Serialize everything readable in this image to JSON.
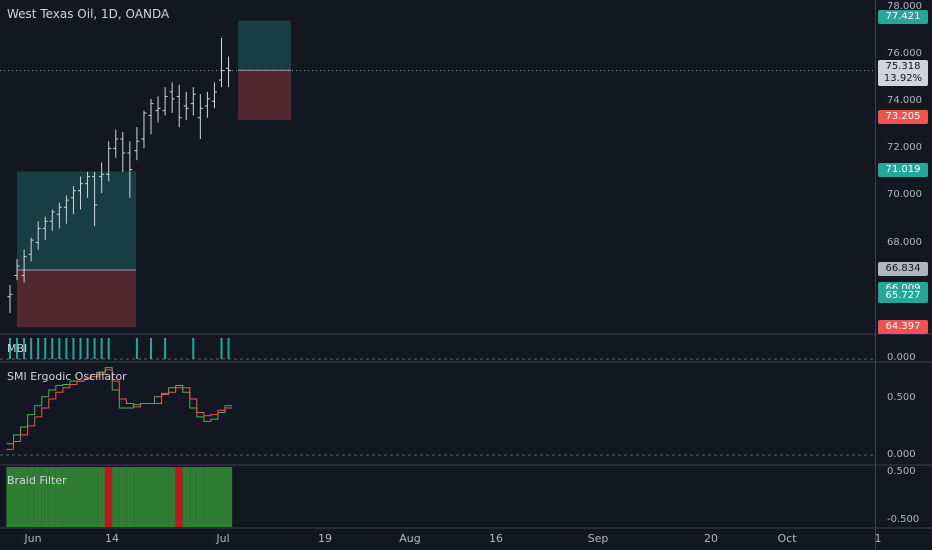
{
  "chart": {
    "title": "West Texas Oil, 1D, OANDA"
  },
  "price_axis": {
    "ticks": [
      "78.000",
      "76.000",
      "74.000",
      "72.000",
      "70.000",
      "68.000"
    ],
    "tags": [
      {
        "text": "77.421",
        "bg": "#26a69a",
        "fg": "#ffffff"
      },
      {
        "text": "75.318",
        "bg": "#d1d4dc",
        "fg": "#131722"
      },
      {
        "text": "13.92%",
        "bg": "#d1d4dc",
        "fg": "#131722"
      },
      {
        "text": "73.205",
        "bg": "#ef5350",
        "fg": "#ffffff"
      },
      {
        "text": "71.019",
        "bg": "#26a69a",
        "fg": "#ffffff"
      },
      {
        "text": "66.834",
        "bg": "#b2b5be",
        "fg": "#131722"
      },
      {
        "text": "66.009",
        "bg": "#26a69a",
        "fg": "#ffffff"
      },
      {
        "text": "65.727",
        "bg": "#26a69a",
        "fg": "#ffffff"
      },
      {
        "text": "64.397",
        "bg": "#ef5350",
        "fg": "#ffffff"
      }
    ]
  },
  "panels": {
    "mbi": {
      "label": "MBI",
      "tick": "0.000"
    },
    "smi": {
      "label": "SMI Ergodic Oscillator",
      "ticks": [
        "0.500",
        "0.000"
      ]
    },
    "braid": {
      "label": "Braid Filter",
      "ticks": [
        "0.500",
        "-0.500"
      ]
    }
  },
  "time_axis": {
    "ticks": [
      "Jun",
      "14",
      "Jul",
      "19",
      "Aug",
      "16",
      "Sep",
      "20",
      "Oct",
      "1"
    ]
  },
  "colors": {
    "background": "#131722",
    "up": "#26a69a",
    "down": "#ef5350",
    "bar": "#d1d4dc",
    "smi_signal": "#4caf50",
    "smi_line": "#ef5350",
    "braid_green": "#2e7d32",
    "braid_red": "#b71c1c"
  },
  "chart_data": {
    "type": "ohlc",
    "title": "West Texas Oil, 1D, OANDA",
    "ylim": [
      64.2,
      78.3
    ],
    "bars": [
      {
        "o": 65.7,
        "h": 66.2,
        "l": 65.0,
        "c": 65.8
      },
      {
        "o": 66.6,
        "h": 67.3,
        "l": 66.4,
        "c": 67.0
      },
      {
        "o": 66.6,
        "h": 67.7,
        "l": 66.3,
        "c": 67.4
      },
      {
        "o": 67.5,
        "h": 68.2,
        "l": 67.2,
        "c": 68.1
      },
      {
        "o": 68.0,
        "h": 68.9,
        "l": 67.7,
        "c": 68.6
      },
      {
        "o": 68.6,
        "h": 69.1,
        "l": 68.1,
        "c": 68.9
      },
      {
        "o": 68.9,
        "h": 69.4,
        "l": 68.5,
        "c": 69.3
      },
      {
        "o": 69.2,
        "h": 69.7,
        "l": 68.6,
        "c": 69.5
      },
      {
        "o": 69.5,
        "h": 70.0,
        "l": 68.8,
        "c": 69.8
      },
      {
        "o": 69.9,
        "h": 70.4,
        "l": 69.2,
        "c": 70.2
      },
      {
        "o": 70.2,
        "h": 70.8,
        "l": 69.4,
        "c": 70.5
      },
      {
        "o": 70.5,
        "h": 71.0,
        "l": 69.9,
        "c": 70.8
      },
      {
        "o": 70.8,
        "h": 71.0,
        "l": 68.7,
        "c": 69.6
      },
      {
        "o": 70.8,
        "h": 71.4,
        "l": 70.1,
        "c": 70.9
      },
      {
        "o": 70.9,
        "h": 72.3,
        "l": 70.6,
        "c": 72.0
      },
      {
        "o": 72.0,
        "h": 72.8,
        "l": 71.6,
        "c": 72.4
      },
      {
        "o": 72.4,
        "h": 72.7,
        "l": 71.0,
        "c": 71.8
      },
      {
        "o": 71.8,
        "h": 72.3,
        "l": 69.9,
        "c": 71.1
      },
      {
        "o": 71.9,
        "h": 72.9,
        "l": 71.5,
        "c": 72.3
      },
      {
        "o": 72.4,
        "h": 73.6,
        "l": 72.0,
        "c": 73.5
      },
      {
        "o": 73.4,
        "h": 74.1,
        "l": 72.6,
        "c": 73.9
      },
      {
        "o": 73.6,
        "h": 74.2,
        "l": 73.1,
        "c": 73.7
      },
      {
        "o": 73.6,
        "h": 74.6,
        "l": 73.4,
        "c": 74.2
      },
      {
        "o": 74.4,
        "h": 74.8,
        "l": 73.5,
        "c": 74.1
      },
      {
        "o": 74.2,
        "h": 74.7,
        "l": 72.9,
        "c": 73.3
      },
      {
        "o": 73.8,
        "h": 74.4,
        "l": 73.2,
        "c": 73.7
      },
      {
        "o": 73.9,
        "h": 74.6,
        "l": 73.4,
        "c": 74.3
      },
      {
        "o": 73.3,
        "h": 74.3,
        "l": 72.4,
        "c": 73.7
      },
      {
        "o": 73.8,
        "h": 74.4,
        "l": 73.3,
        "c": 74.1
      },
      {
        "o": 74.0,
        "h": 74.8,
        "l": 73.7,
        "c": 74.4
      },
      {
        "o": 74.9,
        "h": 76.7,
        "l": 74.6,
        "c": 75.3
      },
      {
        "o": 75.4,
        "h": 75.9,
        "l": 74.6,
        "c": 75.3
      }
    ],
    "positions": [
      {
        "entry": 66.834,
        "target": 71.019,
        "stop": 64.397
      },
      {
        "entry": 75.318,
        "target": 77.421,
        "stop": 73.205
      }
    ],
    "mbi": [
      1,
      1,
      1,
      1,
      1,
      1,
      1,
      1,
      1,
      1,
      1,
      1,
      1,
      1,
      1,
      0,
      0,
      0,
      1,
      0,
      1,
      0,
      1,
      0,
      0,
      0,
      1,
      0,
      0,
      0,
      1,
      1
    ],
    "smi_ylim": [
      -0.05,
      0.9
    ],
    "smi": [
      0.05,
      0.12,
      0.18,
      0.26,
      0.34,
      0.42,
      0.5,
      0.56,
      0.6,
      0.63,
      0.66,
      0.68,
      0.7,
      0.72,
      0.76,
      0.66,
      0.5,
      0.46,
      0.43,
      0.46,
      0.46,
      0.46,
      0.54,
      0.56,
      0.6,
      0.6,
      0.5,
      0.38,
      0.35,
      0.36,
      0.4,
      0.42
    ],
    "smi_signal": [
      0.1,
      0.18,
      0.25,
      0.36,
      0.44,
      0.52,
      0.58,
      0.62,
      0.63,
      0.66,
      0.66,
      0.68,
      0.72,
      0.74,
      0.78,
      0.58,
      0.42,
      0.42,
      0.45,
      0.46,
      0.46,
      0.52,
      0.55,
      0.6,
      0.62,
      0.56,
      0.42,
      0.34,
      0.3,
      0.32,
      0.38,
      0.44
    ],
    "braid": [
      "g",
      "g",
      "g",
      "g",
      "g",
      "g",
      "g",
      "g",
      "g",
      "g",
      "g",
      "g",
      "g",
      "g",
      "r",
      "g",
      "g",
      "g",
      "g",
      "g",
      "g",
      "g",
      "g",
      "g",
      "r",
      "g",
      "g",
      "g",
      "g",
      "g",
      "g",
      "g"
    ]
  }
}
